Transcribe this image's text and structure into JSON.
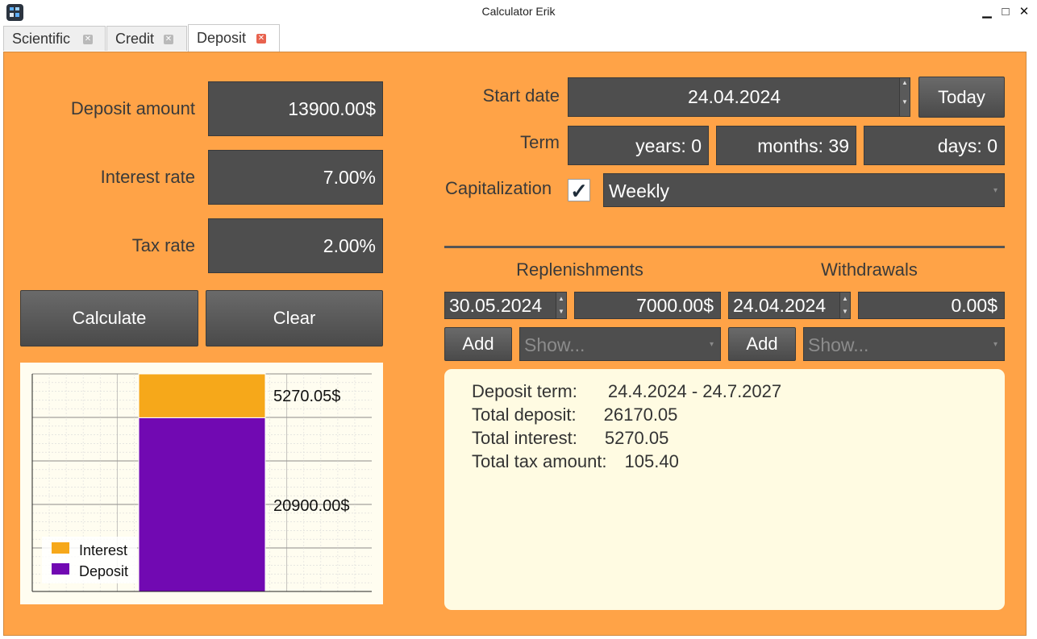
{
  "window": {
    "title": "Calculator Erik",
    "controls": [
      "minimize",
      "maximize",
      "close"
    ]
  },
  "tabs": [
    {
      "label": "Scientific",
      "active": false
    },
    {
      "label": "Credit",
      "active": false
    },
    {
      "label": "Deposit",
      "active": true
    }
  ],
  "colors": {
    "panel_bg": "#ffa347",
    "field_bg": "#4e4e4e",
    "interest": "#f6a81a",
    "deposit": "#7109b2",
    "results_bg": "#fffbe2"
  },
  "inputs": {
    "deposit_amount": {
      "label": "Deposit amount",
      "value": "13900.00$"
    },
    "interest_rate": {
      "label": "Interest rate",
      "value": "7.00%"
    },
    "tax_rate": {
      "label": "Tax rate",
      "value": "2.00%"
    }
  },
  "buttons": {
    "calculate": "Calculate",
    "clear": "Clear",
    "today": "Today",
    "add_replenishment": "Add",
    "add_withdrawal": "Add"
  },
  "start_date": {
    "label": "Start date",
    "value": "24.04.2024"
  },
  "term": {
    "label": "Term",
    "years": "years: 0",
    "months": "months: 39",
    "days": "days: 0"
  },
  "capitalization": {
    "label": "Capitalization",
    "checked": true,
    "check_glyph": "✓",
    "selected": "Weekly"
  },
  "replenishments": {
    "header": "Replenishments",
    "date": "30.05.2024",
    "amount": "7000.00$",
    "show_placeholder": "Show..."
  },
  "withdrawals": {
    "header": "Withdrawals",
    "date": "24.04.2024",
    "amount": "0.00$",
    "show_placeholder": "Show..."
  },
  "chart_data": {
    "type": "bar",
    "stacked": true,
    "categories": [
      ""
    ],
    "series": [
      {
        "name": "Deposit",
        "values": [
          20900.0
        ],
        "label": "20900.00$",
        "color": "#7109b2"
      },
      {
        "name": "Interest",
        "values": [
          5270.05
        ],
        "label": "5270.05$",
        "color": "#f6a81a"
      }
    ],
    "ylim": [
      0,
      26170.05
    ],
    "grid": true,
    "legend_position": "bottom-left"
  },
  "results": {
    "deposit_term": {
      "label": "Deposit term:",
      "value": "24.4.2024 - 24.7.2027"
    },
    "total_deposit": {
      "label": "Total deposit:",
      "value": "26170.05"
    },
    "total_interest": {
      "label": "Total interest:",
      "value": "5270.05"
    },
    "total_tax": {
      "label": "Total tax amount:",
      "value": "105.40"
    }
  }
}
